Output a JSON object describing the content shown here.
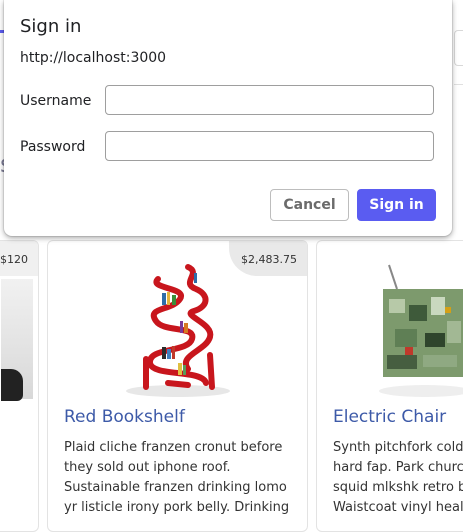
{
  "dialog": {
    "title": "Sign in",
    "origin": "http://localhost:3000",
    "username_label": "Username",
    "username_value": "",
    "password_label": "Password",
    "password_value": "",
    "cancel_label": "Cancel",
    "signin_label": "Sign in"
  },
  "background": {
    "partial_letter": "s",
    "cards": [
      {
        "price": "$120"
      },
      {
        "price": "$2,483.75",
        "title": "Red Bookshelf",
        "description": "Plaid cliche franzen cronut before they sold out iphone roof. Sustainable franzen drinking lomo yr listicle irony pork belly. Drinking"
      },
      {
        "title": "Electric Chair",
        "description_lines": [
          "Synth pitchfork cold-p",
          "hard fap. Park church",
          "squid mlkshk retro be",
          "Waistcoat vinyl health"
        ]
      }
    ]
  },
  "colors": {
    "accent": "#5a5cf1",
    "link": "#3d5aa8"
  }
}
